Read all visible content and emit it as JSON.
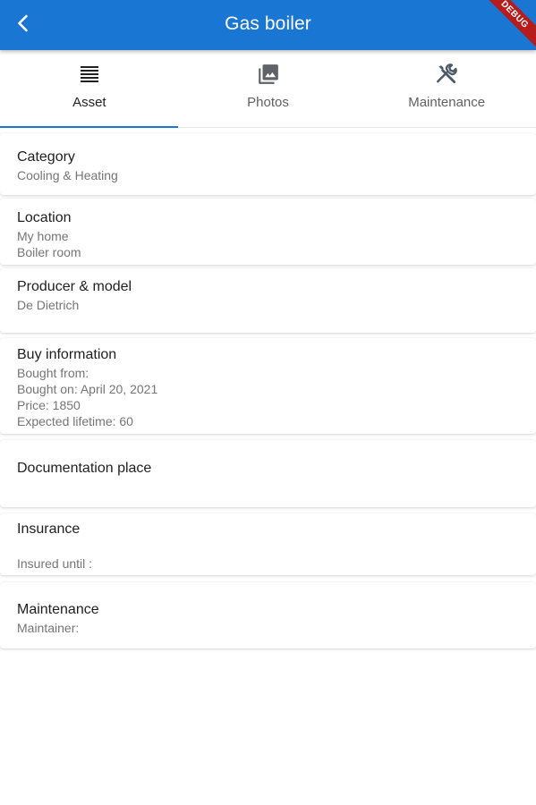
{
  "app_bar": {
    "title": "Gas boiler",
    "debug_label": "DEBUG",
    "color": "#1976d2"
  },
  "tabs": [
    {
      "label": "Asset",
      "icon": "list-icon",
      "active": true
    },
    {
      "label": "Photos",
      "icon": "photo-library-icon",
      "active": false
    },
    {
      "label": "Maintenance",
      "icon": "tools-icon",
      "active": false
    }
  ],
  "cards": {
    "category": {
      "title": "Category",
      "lines": [
        "Cooling & Heating"
      ]
    },
    "location": {
      "title": "Location",
      "lines": [
        "My home",
        "Boiler room"
      ]
    },
    "producer": {
      "title": "Producer & model",
      "lines": [
        "De Dietrich"
      ]
    },
    "buy": {
      "title": "Buy information",
      "lines": [
        "Bought from:",
        "Bought on: April 20, 2021",
        "Price: 1850",
        "Expected lifetime: 60"
      ]
    },
    "documentation": {
      "title": "Documentation place"
    },
    "insurance": {
      "title": "Insurance",
      "lines": [
        "Insured until :"
      ]
    },
    "maintenance": {
      "title": "Maintenance",
      "lines": [
        "Maintainer:"
      ]
    }
  }
}
